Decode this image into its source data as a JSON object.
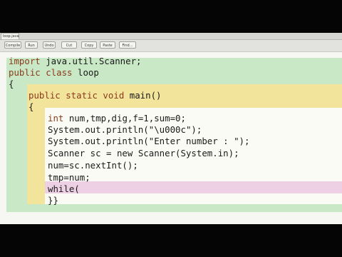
{
  "tab": {
    "title": "loop.java"
  },
  "toolbar": {
    "buttons": [
      "Compile",
      "Run",
      "Undo",
      "Cut",
      "Copy",
      "Paste",
      "Find..."
    ]
  },
  "code": {
    "lines": [
      {
        "kw": "import",
        "rest": " java.util.Scanner;"
      },
      {
        "kw": "public class",
        "rest": " loop"
      },
      {
        "kw": "",
        "rest": "{"
      },
      {
        "kw": "public static void",
        "rest": " main()"
      },
      {
        "kw": "",
        "rest": "{"
      },
      {
        "kw": "int",
        "rest": " num,tmp,dig,f=1,sum=0;"
      },
      {
        "kw": "",
        "rest": "System.out.println(\"\\u000c\");"
      },
      {
        "kw": "",
        "rest": "System.out.println(\"Enter number : \");"
      },
      {
        "kw": "",
        "rest": "Scanner sc = new Scanner(System.in);"
      },
      {
        "kw": "",
        "rest": "num=sc.nextInt();"
      },
      {
        "kw": "",
        "rest": "tmp=num;"
      },
      {
        "kw": "",
        "rest": "while("
      },
      {
        "kw": "",
        "rest": "}}"
      }
    ]
  },
  "colors": {
    "class_scope": "#c8e8c6",
    "method_scope": "#f3e49c",
    "body_scope": "#fbfbf6",
    "while_scope": "#edd0e3",
    "keyword": "#8a3b1c"
  }
}
